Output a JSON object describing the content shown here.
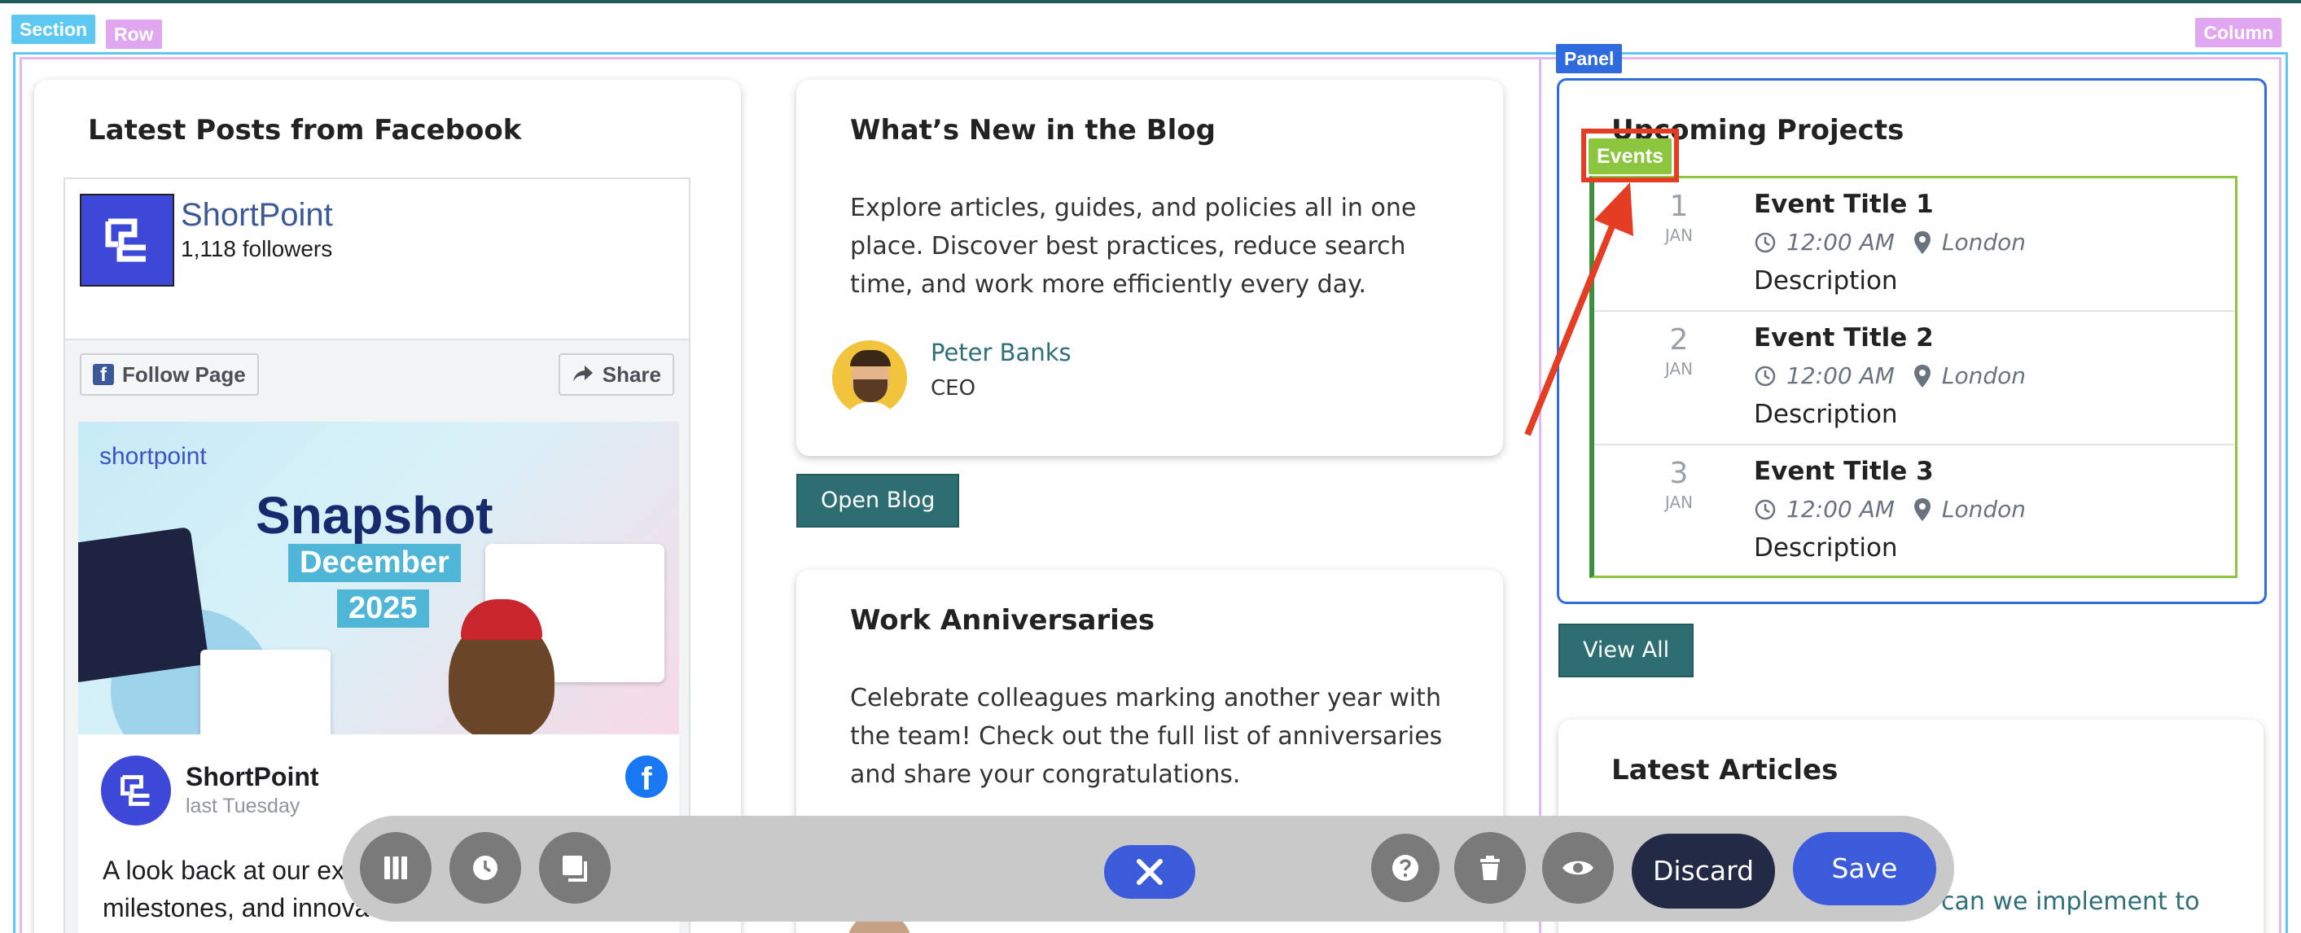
{
  "editor_labels": {
    "section": "Section",
    "row": "Row",
    "column": "Column",
    "panel": "Panel",
    "events": "Events"
  },
  "facebook_card": {
    "title": "Latest Posts from Facebook",
    "page_name": "ShortPoint",
    "followers": "1,118 followers",
    "follow_label": "Follow Page",
    "share_label": "Share",
    "image": {
      "brand": "shortpoint",
      "headline": "Snapshot",
      "month": "December",
      "year": "2025"
    },
    "post_author": "ShortPoint",
    "post_time": "last Tuesday",
    "post_text": "A look back at our extr... Celebrating a year of s... milestones, and innovation. All this in the"
  },
  "blog_card": {
    "title": "What’s New in the Blog",
    "body": "Explore articles, guides, and policies all in one place. Discover best practices, reduce search time, and work more efficiently every day.",
    "author_name": "Peter Banks",
    "author_role": "CEO",
    "button_label": "Open Blog"
  },
  "anniversary_card": {
    "title": "Work Anniversaries",
    "body": "Celebrate colleagues marking another year with the team! Check out the full list of anniversaries and share your congratulations."
  },
  "projects_panel": {
    "title": "Upcoming Projects",
    "events": [
      {
        "day": "1",
        "month": "JAN",
        "title": "Event Title 1",
        "time": "12:00 AM",
        "location": "London",
        "description": "Description"
      },
      {
        "day": "2",
        "month": "JAN",
        "title": "Event Title 2",
        "time": "12:00 AM",
        "location": "London",
        "description": "Description"
      },
      {
        "day": "3",
        "month": "JAN",
        "title": "Event Title 3",
        "time": "12:00 AM",
        "location": "London",
        "description": "Description"
      }
    ],
    "button_label": "View All"
  },
  "articles_card": {
    "title": "Latest Articles",
    "snippet": "can we implement to"
  },
  "toolbar": {
    "discard_label": "Discard",
    "save_label": "Save",
    "icons": [
      "columns-icon",
      "history-icon",
      "layers-icon",
      "close-icon",
      "help-icon",
      "trash-icon",
      "preview-icon"
    ]
  },
  "colors": {
    "accent_teal": "#2d6e73",
    "panel_blue": "#2f6bde",
    "events_green": "#8cc63f",
    "annotation_red": "#e53c24",
    "save_blue": "#3b5bdb",
    "discard_navy": "#222a45"
  }
}
